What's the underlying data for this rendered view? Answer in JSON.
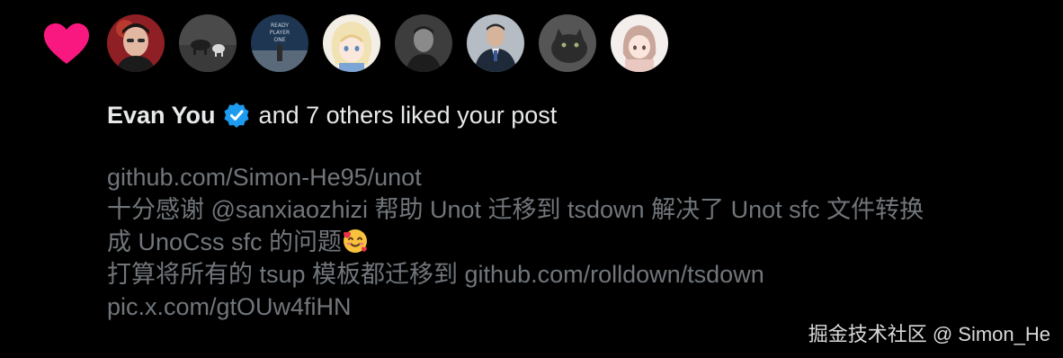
{
  "notification": {
    "type_icon": "heart-icon",
    "accent_color": "#f91880",
    "verified_color": "#1d9bf0",
    "avatars": [
      {
        "name": "avatar-red-portrait"
      },
      {
        "name": "avatar-grey-animals"
      },
      {
        "name": "avatar-ready-player-one"
      },
      {
        "name": "avatar-anime-girl"
      },
      {
        "name": "avatar-grey-portrait"
      },
      {
        "name": "avatar-suit-portrait"
      },
      {
        "name": "avatar-cat"
      },
      {
        "name": "avatar-light-character"
      }
    ],
    "actor": "Evan You",
    "actor_verified": true,
    "action_text": "and 7 others liked your post",
    "post_preview": {
      "line1": "github.com/Simon-He95/unot",
      "line2": "十分感谢 @sanxiaozhizi 帮助 Unot 迁移到 tsdown 解决了 Unot  sfc 文件转换",
      "line3": "成 UnoCss sfc 的问题",
      "line3_emoji": "smiling-face-with-hearts",
      "line4": "打算将所有的 tsup 模板都迁移到 github.com/rolldown/tsdown",
      "line5": "pic.x.com/gtOUw4fiHN"
    }
  },
  "watermark": "掘金技术社区 @ Simon_He"
}
